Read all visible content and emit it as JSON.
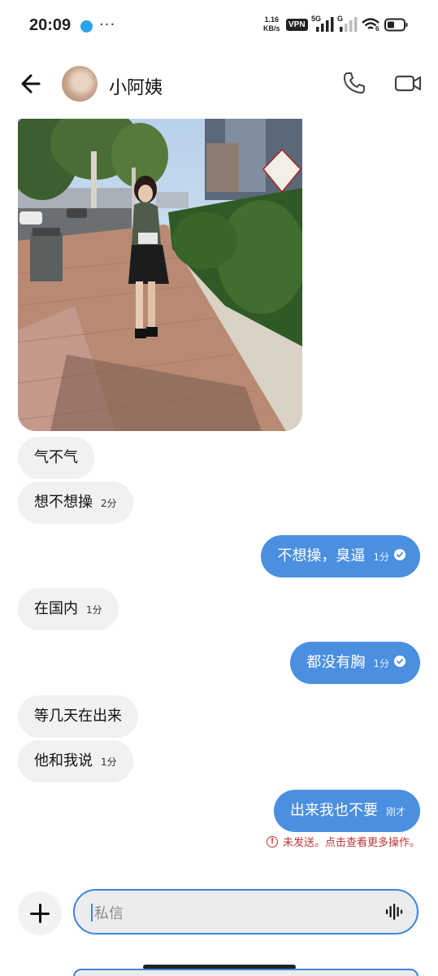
{
  "status_bar": {
    "time": "20:09",
    "speed_value": "1.16",
    "speed_unit": "KB/s",
    "vpn": "VPN",
    "net_5g": "5G",
    "net_g": "G",
    "wifi_sub": "6"
  },
  "header": {
    "contact_name": "小阿姨"
  },
  "messages": [
    {
      "side": "in",
      "text": "气不气",
      "time": ""
    },
    {
      "side": "in",
      "text": "想不想操",
      "time": "2分"
    },
    {
      "side": "out",
      "text": "不想操，臭逼",
      "time": "1分",
      "read": true
    },
    {
      "side": "in",
      "text": "在国内",
      "time": "1分"
    },
    {
      "side": "out",
      "text": "都没有胸",
      "time": "1分",
      "read": true
    },
    {
      "side": "in",
      "text": "等几天在出来",
      "time": ""
    },
    {
      "side": "in",
      "text": "他和我说",
      "time": "1分"
    },
    {
      "side": "out",
      "text": "出来我也不要",
      "time": "刚才",
      "read": false
    }
  ],
  "error_notice": "未发送。点击查看更多操作。",
  "composer": {
    "placeholder": "私信"
  },
  "colors": {
    "outgoing_bubble": "#4a8fe0",
    "incoming_bubble": "#eff1f3",
    "error": "#c03434",
    "input_border": "#3b86dc"
  },
  "icons": [
    "back-arrow-icon",
    "phone-icon",
    "video-camera-icon",
    "plus-icon",
    "voice-waveform-icon",
    "read-check-icon",
    "error-circle-icon"
  ]
}
